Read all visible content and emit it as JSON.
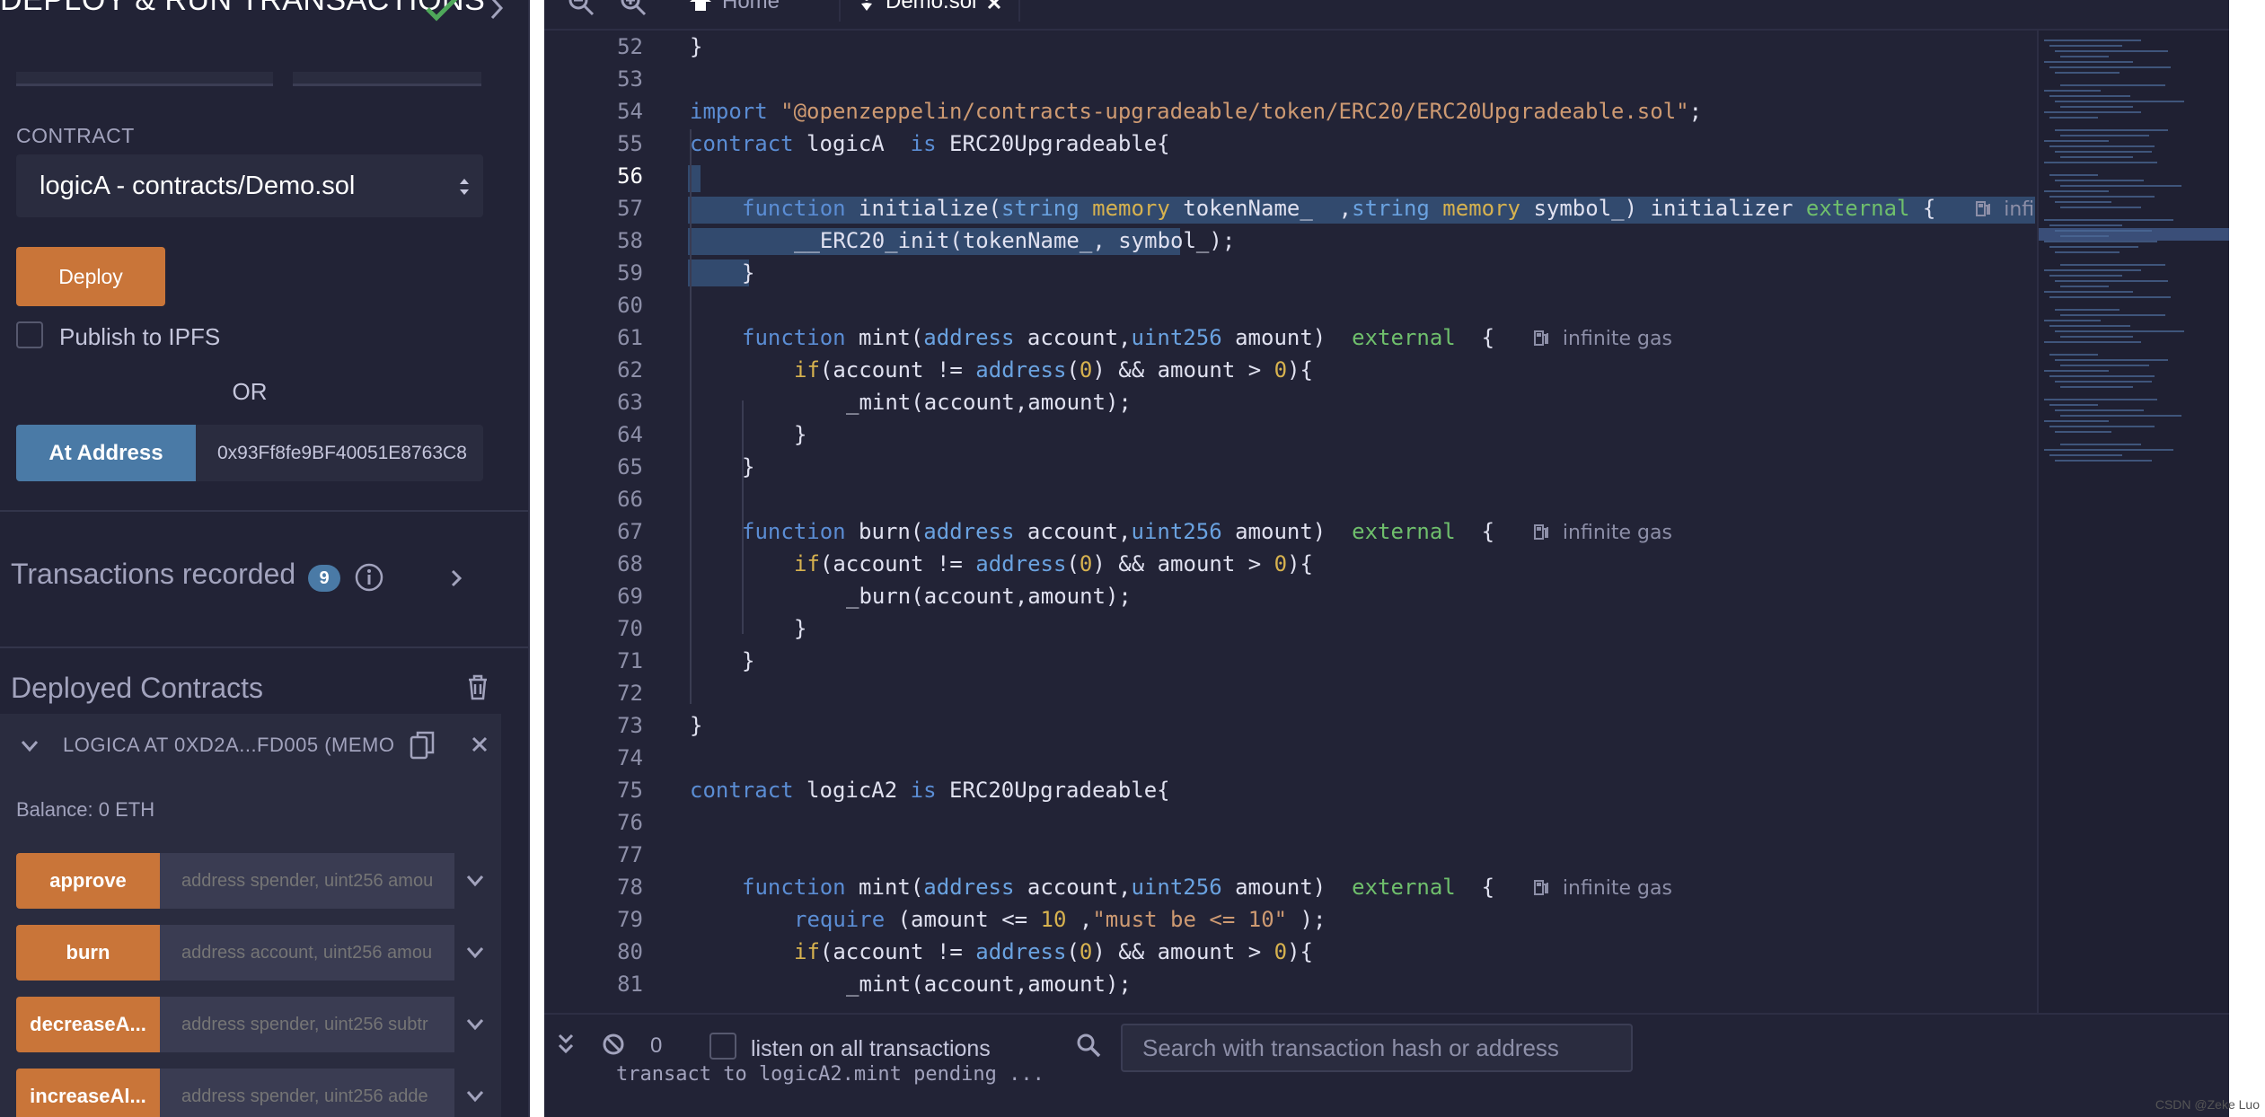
{
  "left_panel": {
    "title": "DEPLOY & RUN TRANSACTIONS",
    "contract_label": "CONTRACT",
    "contract_selected": "logicA - contracts/Demo.sol",
    "deploy_label": "Deploy",
    "publish_ipfs_label": "Publish to IPFS",
    "or_label": "OR",
    "at_address_label": "At Address",
    "at_address_value": "0x93Ff8fe9BF40051E8763C8",
    "transactions_recorded_label": "Transactions recorded",
    "transactions_recorded_count": "9",
    "deployed_contracts_label": "Deployed Contracts",
    "instance_name": "LOGICA AT 0XD2A...FD005 (MEMO",
    "balance": "Balance: 0 ETH",
    "functions": [
      {
        "label": "approve",
        "placeholder": "address spender, uint256 amou"
      },
      {
        "label": "burn",
        "placeholder": "address account, uint256 amou"
      },
      {
        "label": "decreaseA...",
        "placeholder": "address spender, uint256 subtr"
      },
      {
        "label": "increaseAl...",
        "placeholder": "address spender, uint256 adde"
      }
    ]
  },
  "editor": {
    "tabs": {
      "home": "Home",
      "file": "Demo.sol"
    },
    "lines": {
      "n52": "52",
      "n53": "53",
      "n54": "54",
      "n55": "55",
      "n56": "56",
      "n57": "57",
      "n58": "58",
      "n59": "59",
      "n60": "60",
      "n61": "61",
      "n62": "62",
      "n63": "63",
      "n64": "64",
      "n65": "65",
      "n66": "66",
      "n67": "67",
      "n68": "68",
      "n69": "69",
      "n70": "70",
      "n71": "71",
      "n72": "72",
      "n73": "73",
      "n74": "74",
      "n75": "75",
      "n76": "76",
      "n77": "77",
      "n78": "78",
      "n79": "79",
      "n80": "80",
      "n81": "81"
    },
    "code": {
      "l52": "}",
      "l54_kw": "import",
      "l54_str": "\"@openzeppelin/contracts-upgradeable/token/ERC20/ERC20Upgradeable.sol\"",
      "l54_end": ";",
      "l55_kw": "contract",
      "l55_name": " logicA  ",
      "l55_is": "is",
      "l55_base": " ERC20Upgradeable{",
      "l57_kw": "function",
      "l57_name": " initialize(",
      "l57_t1": "string",
      "l57_m1": " memory",
      "l57_p1": " tokenName_  ,",
      "l57_t2": "string",
      "l57_m2": " memory",
      "l57_p2": " symbol_) initializer ",
      "l57_ext": "external",
      "l57_end": " {",
      "l57_gas": "infi",
      "l58": "__ERC20_init(tokenName_, symbol_);",
      "l59": "}",
      "mint_kw": "function",
      "mint_name": " mint(",
      "burn_name": " burn(",
      "addr_t": "address",
      "acct": " account,",
      "uint_t": "uint256",
      "amt": " amount)  ",
      "ext": "external",
      "brace": "  {",
      "gas": "infinite gas",
      "if_kw": "if",
      "cond_a": "(account != ",
      "zero": "0",
      "cond_b": ") && amount > ",
      "cond_c": "){",
      "mint_call": "_mint(account,amount);",
      "burn_call": "_burn(account,amount);",
      "close": "}",
      "l75_kw": "contract",
      "l75_name": " logicA2 ",
      "l75_is": "is",
      "l75_base": " ERC20Upgradeable{",
      "l79_req": "require",
      "l79_a": " (amount <= ",
      "l79_num": "10",
      "l79_b": " ,",
      "l79_str": "\"must be <= 10\"",
      "l79_c": " );"
    }
  },
  "terminal": {
    "pending_count": "0",
    "listen_label": "listen on all transactions",
    "search_placeholder": "Search with transaction hash or address",
    "log_line": "transact to logicA2.mint pending ..."
  },
  "watermark": "CSDN @Zeke Luo",
  "colors": {
    "panel_bg": "#222336",
    "deploy_orange": "#c97539",
    "at_address_blue": "#4a7aa6",
    "selection": "#324a6e"
  }
}
